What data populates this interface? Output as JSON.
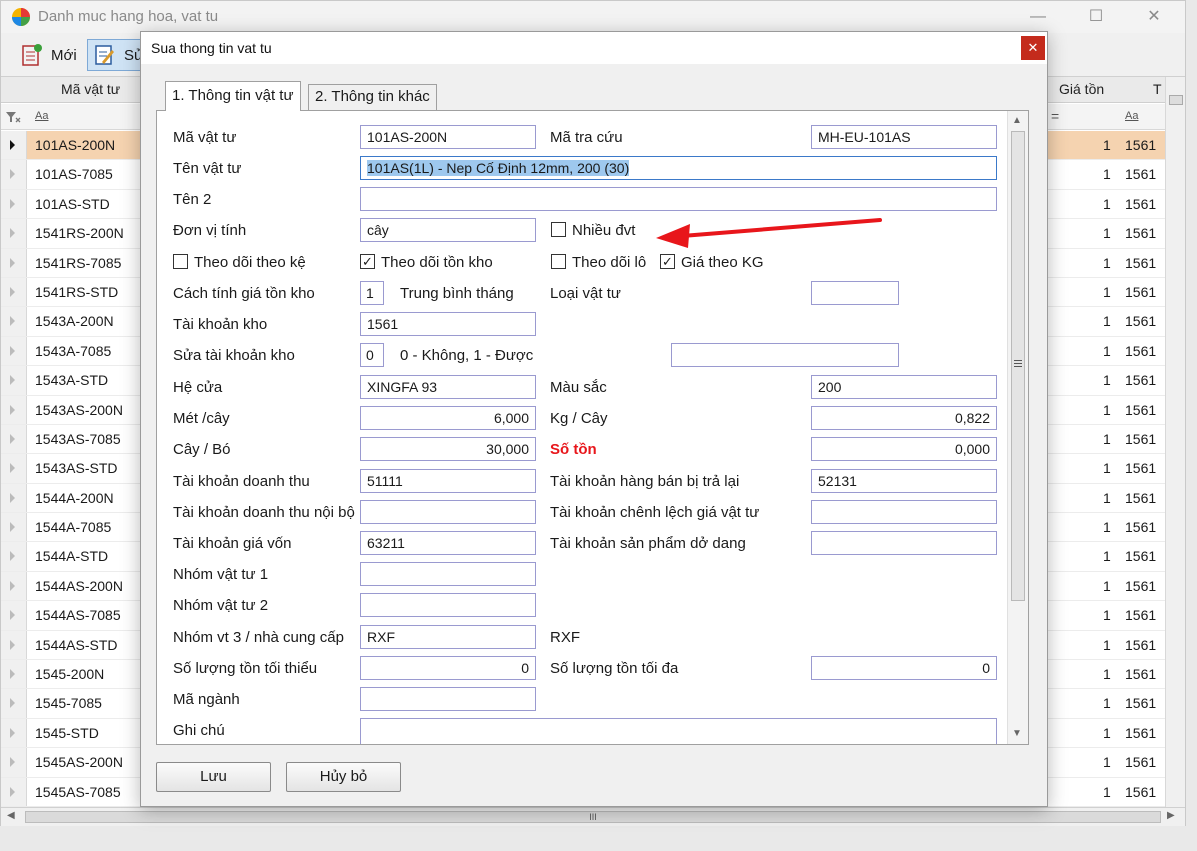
{
  "background_window": {
    "title": "Danh muc hang hoa, vat tu",
    "controls": {
      "minimize": "—",
      "maximize": "☐",
      "close": "✕"
    },
    "toolbar": {
      "new_label": "Mới",
      "edit_label": "Sử"
    },
    "columns": {
      "code": "Mã vật tư",
      "price": "Giá tồn",
      "last": "T"
    },
    "filter": {
      "code": "Aa",
      "price": "=",
      "last": "Aa"
    },
    "rows": [
      {
        "code": "101AS-200N",
        "num": "1",
        "acc": "1561"
      },
      {
        "code": "101AS-7085",
        "num": "1",
        "acc": "1561"
      },
      {
        "code": "101AS-STD",
        "num": "1",
        "acc": "1561"
      },
      {
        "code": "1541RS-200N",
        "num": "1",
        "acc": "1561"
      },
      {
        "code": "1541RS-7085",
        "num": "1",
        "acc": "1561"
      },
      {
        "code": "1541RS-STD",
        "num": "1",
        "acc": "1561"
      },
      {
        "code": "1543A-200N",
        "num": "1",
        "acc": "1561"
      },
      {
        "code": "1543A-7085",
        "num": "1",
        "acc": "1561"
      },
      {
        "code": "1543A-STD",
        "num": "1",
        "acc": "1561"
      },
      {
        "code": "1543AS-200N",
        "num": "1",
        "acc": "1561"
      },
      {
        "code": "1543AS-7085",
        "num": "1",
        "acc": "1561"
      },
      {
        "code": "1543AS-STD",
        "num": "1",
        "acc": "1561"
      },
      {
        "code": "1544A-200N",
        "num": "1",
        "acc": "1561"
      },
      {
        "code": "1544A-7085",
        "num": "1",
        "acc": "1561"
      },
      {
        "code": "1544A-STD",
        "num": "1",
        "acc": "1561"
      },
      {
        "code": "1544AS-200N",
        "num": "1",
        "acc": "1561"
      },
      {
        "code": "1544AS-7085",
        "num": "1",
        "acc": "1561"
      },
      {
        "code": "1544AS-STD",
        "num": "1",
        "acc": "1561"
      },
      {
        "code": "1545-200N",
        "num": "1",
        "acc": "1561"
      },
      {
        "code": "1545-7085",
        "num": "1",
        "acc": "1561"
      },
      {
        "code": "1545-STD",
        "num": "1",
        "acc": "1561"
      },
      {
        "code": "1545AS-200N",
        "num": "1",
        "acc": "1561"
      },
      {
        "code": "1545AS-7085",
        "num": "1",
        "acc": "1561"
      }
    ],
    "selected_row": 0,
    "hscroll_grip": "III"
  },
  "dialog": {
    "title": "Sua thong tin vat tu",
    "close": "✕",
    "tabs": [
      {
        "label": "1. Thông tin vật tư"
      },
      {
        "label": "2. Thông tin khác"
      }
    ],
    "labels": {
      "ma_vat_tu": "Mã vật tư",
      "ma_tra_cuu": "Mã tra cứu",
      "ten_vat_tu": "Tên vật tư",
      "ten_2": "Tên 2",
      "don_vi_tinh": "Đơn vị tính",
      "nhieu_dvt": "Nhiều đvt",
      "theo_doi_theo_ke": "Theo dõi theo kệ",
      "theo_doi_ton_kho": "Theo dõi tồn kho",
      "theo_doi_lo": "Theo dõi lô",
      "gia_theo_kg": "Giá theo KG",
      "cach_tinh_gia": "Cách tính giá tồn kho",
      "cach_tinh_gia_desc": "Trung bình tháng",
      "loai_vat_tu": "Loại vật tư",
      "tai_khoan_kho": "Tài khoản kho",
      "sua_tai_khoan_kho": "Sửa tài khoản kho",
      "sua_tai_khoan_kho_desc": "0 - Không, 1 - Được",
      "he_cua": "Hệ cửa",
      "mau_sac": "Màu sắc",
      "met_cay": "Mét /cây",
      "kg_cay": "Kg / Cây",
      "cay_bo": "Cây / Bó",
      "so_ton": "Số tồn",
      "tk_doanh_thu": "Tài khoản doanh thu",
      "tk_hang_ban_tra_lai": "Tài khoản hàng bán bị trả lại",
      "tk_doanh_thu_noi_bo": "Tài khoản doanh thu nội bộ",
      "tk_chenh_lech_gia": "Tài khoản chênh lệch giá vật tư",
      "tk_gia_von": "Tài khoản giá vốn",
      "tk_sp_do_dang": "Tài khoản sản phẩm dở dang",
      "nhom_vat_tu_1": "Nhóm vật tư 1",
      "nhom_vat_tu_2": "Nhóm vật tư 2",
      "nhom_vt_3": "Nhóm vt 3 / nhà cung cấp",
      "nhom_vt_3_name": "RXF",
      "sl_ton_toi_thieu": "Số lượng tồn tối thiểu",
      "sl_ton_toi_da": "Số lượng tồn tối đa",
      "ma_nganh": "Mã ngành",
      "ghi_chu": "Ghi chú"
    },
    "values": {
      "ma_vat_tu": "101AS-200N",
      "ma_tra_cuu": "MH-EU-101AS",
      "ten_vat_tu": "101AS(1L) - Nep Cố Định 12mm, 200 (30)",
      "ten_2": "",
      "don_vi_tinh": "cây",
      "cach_tinh_gia": "1",
      "loai_vat_tu": "",
      "tai_khoan_kho": "1561",
      "sua_tai_khoan_kho": "0",
      "sua_tai_khoan_kho_extra": "",
      "he_cua": "XINGFA 93",
      "mau_sac": "200",
      "met_cay": "6,000",
      "kg_cay": "0,822",
      "cay_bo": "30,000",
      "so_ton": "0,000",
      "tk_doanh_thu": "51111",
      "tk_hang_ban_tra_lai": "52131",
      "tk_doanh_thu_noi_bo": "",
      "tk_chenh_lech_gia": "",
      "tk_gia_von": "63211",
      "tk_sp_do_dang": "",
      "nhom_vat_tu_1": "",
      "nhom_vat_tu_2": "",
      "nhom_vt_3": "RXF",
      "sl_ton_toi_thieu": "0",
      "sl_ton_toi_da": "0",
      "ma_nganh": "",
      "ghi_chu": ""
    },
    "checks": {
      "nhieu_dvt": false,
      "theo_doi_theo_ke": false,
      "theo_doi_ton_kho": true,
      "theo_doi_lo": false,
      "gia_theo_kg": true
    },
    "buttons": {
      "save": "Lưu",
      "cancel": "Hủy bỏ"
    },
    "check_glyph": "✓"
  },
  "colors": {
    "selected_row": "#f5d3b0",
    "highlight": "#9ec8ee",
    "red_label": "#e8161b",
    "close_button": "#c42b1c",
    "annotation_arrow": "#e8161b"
  }
}
